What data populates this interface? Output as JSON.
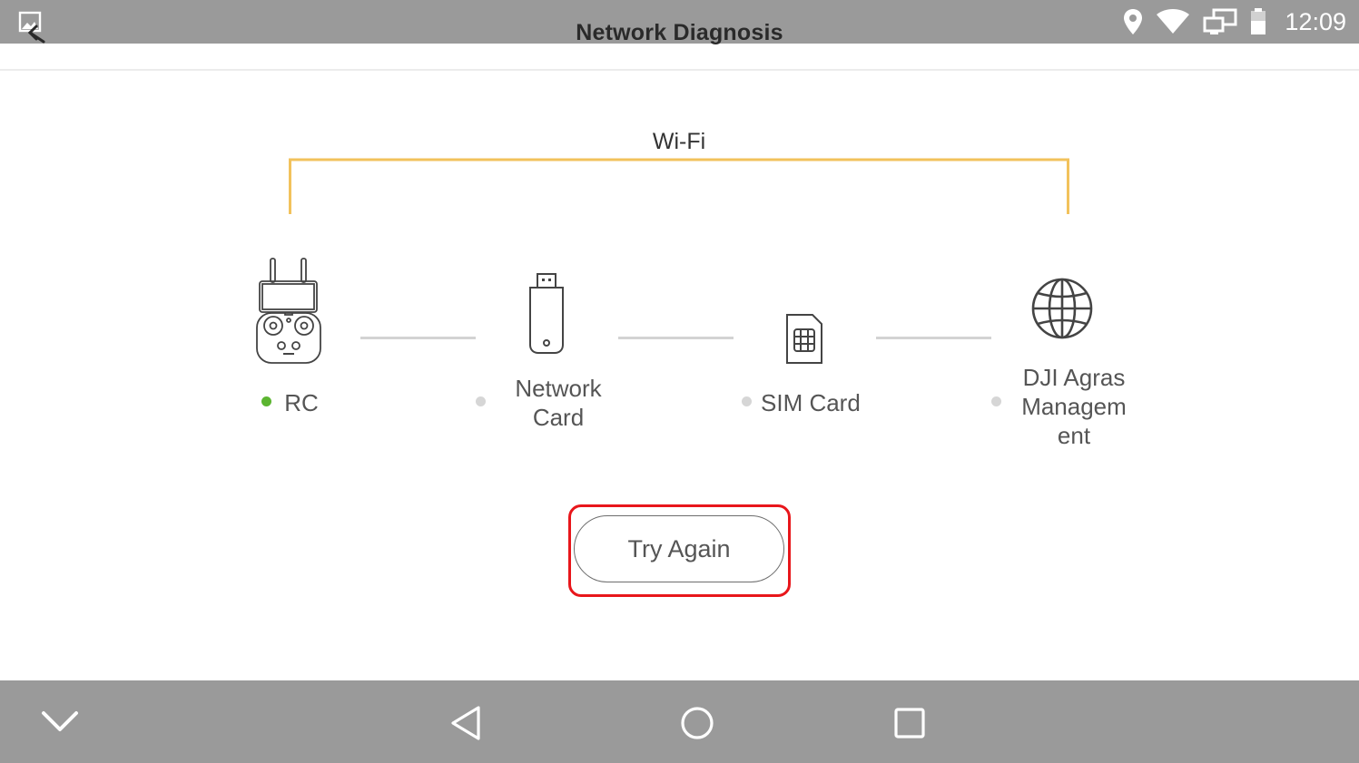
{
  "status_bar": {
    "title": "Network Diagnosis",
    "clock": "12:09",
    "icons": [
      "gallery-icon",
      "back-arrow-icon",
      "location-icon",
      "wifi-icon",
      "screen-mirror-icon",
      "battery-icon"
    ]
  },
  "diagram": {
    "link_label": "Wi-Fi",
    "link_color": "#f2c25c",
    "nodes": [
      {
        "id": "rc",
        "label": "RC",
        "status_color": "#5cb531",
        "icon": "remote-controller-icon"
      },
      {
        "id": "network-card",
        "label": "Network Card",
        "status_color": "#d6d6d6",
        "icon": "usb-dongle-icon"
      },
      {
        "id": "sim-card",
        "label": "SIM Card",
        "status_color": "#d6d6d6",
        "icon": "sim-card-icon"
      },
      {
        "id": "dji-agras",
        "label": "DJI Agras Management",
        "status_color": "#d6d6d6",
        "icon": "globe-icon"
      }
    ]
  },
  "actions": {
    "try_again": "Try Again",
    "highlight_color": "#e8161b"
  },
  "nav_bar": {
    "icons": [
      "chevron-down-icon",
      "back-triangle-icon",
      "home-circle-icon",
      "recents-square-icon"
    ]
  }
}
